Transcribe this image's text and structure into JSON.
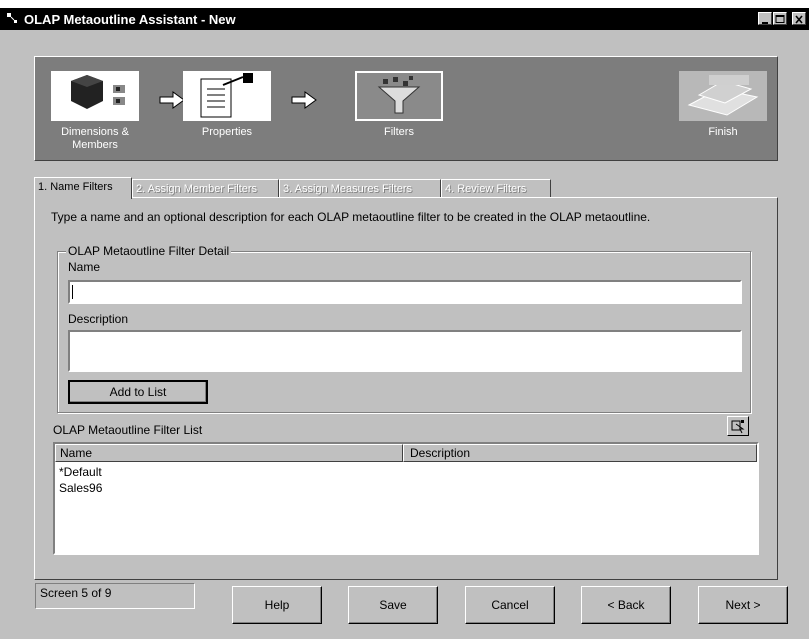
{
  "window": {
    "title": "OLAP Metaoutline Assistant - New"
  },
  "steps": [
    {
      "label": "Dimensions &\nMembers",
      "icon": "cube-members-icon"
    },
    {
      "label": "Properties",
      "icon": "properties-document-icon"
    },
    {
      "label": "Filters",
      "icon": "funnel-filter-icon"
    },
    {
      "label": "Finish",
      "icon": "finish-icon"
    }
  ],
  "tabs": [
    {
      "label": "1. Name Filters",
      "active": true
    },
    {
      "label": "2. Assign Member Filters",
      "active": false
    },
    {
      "label": "3. Assign Measures Filters",
      "active": false
    },
    {
      "label": "4. Review Filters",
      "active": false
    }
  ],
  "instructions": "Type a name and an optional description for each OLAP metaoutline filter to be created in the OLAP metaoutline.",
  "detail": {
    "legend": "OLAP Metaoutline Filter Detail",
    "name_label": "Name",
    "name_value": "",
    "description_label": "Description",
    "description_value": "",
    "add_button": "Add to List"
  },
  "filter_list": {
    "label": "OLAP Metaoutline Filter List",
    "columns": [
      "Name",
      "Description"
    ],
    "rows": [
      {
        "name": "*Default",
        "description": ""
      },
      {
        "name": "Sales96",
        "description": ""
      }
    ]
  },
  "status": "Screen 5 of 9",
  "buttons": {
    "help": "Help",
    "save": "Save",
    "cancel": "Cancel",
    "back": "< Back",
    "next": "Next >"
  },
  "colors": {
    "titlebar": "#000000",
    "face": "#c0c0c0",
    "wizard_bar": "#7d7d7d"
  }
}
